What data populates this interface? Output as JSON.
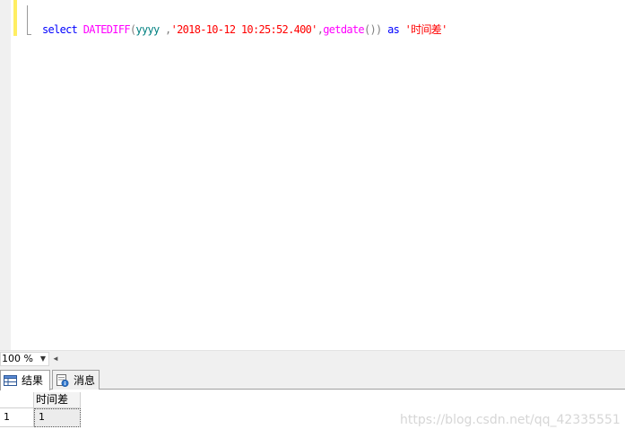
{
  "editor": {
    "sql": {
      "select": "select",
      "func": "DATEDIFF",
      "paren_open": "(",
      "part": "yyyy",
      "comma1": " ,",
      "date_literal": "'2018-10-12 10:25:52.400'",
      "comma2": ",",
      "getdate": "getdate",
      "paren_inner": "()",
      "paren_close": ")",
      "as": "as",
      "alias": "'时间差'"
    }
  },
  "zoom": {
    "value": "100 %"
  },
  "tabs": [
    {
      "label": "结果",
      "icon": "grid-icon",
      "active": true
    },
    {
      "label": "消息",
      "icon": "message-icon",
      "active": false
    }
  ],
  "grid": {
    "columns": [
      "时间差"
    ],
    "rows": [
      {
        "row_number": "1",
        "cells": [
          "1"
        ]
      }
    ]
  },
  "watermark": "https://blog.csdn.net/qq_42335551",
  "colors": {
    "keyword": "#0000ff",
    "function": "#ff00ff",
    "operator": "#808080",
    "string": "#ff0000",
    "datepart": "#008080",
    "change_marker": "#ffee62"
  }
}
